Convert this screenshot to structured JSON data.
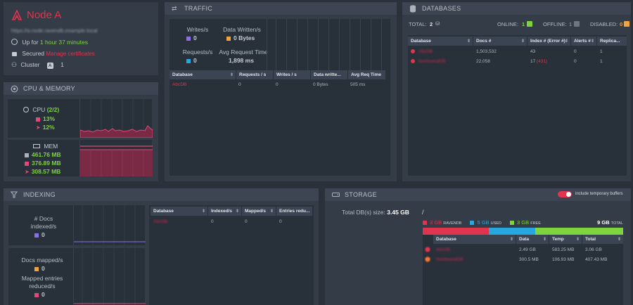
{
  "node": {
    "name": "Node A",
    "url": "https://a.node.ravendb.example.local",
    "uptime_label": "Up for",
    "uptime": "1 hour 37 minutes",
    "secured_label": "Secured",
    "manage_certs": "Manage certificates",
    "cluster_label": "Cluster",
    "cluster_node": "A",
    "cluster_count": "1"
  },
  "cpu_mem": {
    "title": "CPU & MEMORY",
    "cpu_label": "CPU",
    "cpu_cores": "(2/2)",
    "cpu_machine": "13%",
    "cpu_process": "12%",
    "mem_label": "MEM",
    "mem_total": "461.76 MB",
    "mem_working": "376.89 MB",
    "mem_managed": "308.57 MB"
  },
  "traffic": {
    "title": "TRAFFIC",
    "writes_label": "Writes/s",
    "writes": "0",
    "data_written_label": "Data Written/s",
    "data_written": "0 Bytes",
    "requests_label": "Requests/s",
    "requests": "0",
    "avg_req_label": "Avg Request Time",
    "avg_req": "1,898 ms",
    "columns": [
      "Database",
      "Requests / s",
      "Writes / s",
      "Data writte...",
      "Avg Req Time"
    ],
    "rows": [
      [
        "AbcDB",
        "0",
        "0",
        "0 Bytes",
        "505 ms"
      ]
    ]
  },
  "databases": {
    "title": "DATABASES",
    "total_label": "TOTAL:",
    "total": "2",
    "online_label": "ONLINE:",
    "online": "1",
    "offline_label": "OFFLINE:",
    "offline": "1",
    "disabled_label": "DISABLED:",
    "disabled": "0",
    "columns": [
      "Database",
      "Docs #",
      "Index # (Error #)",
      "Alerts #",
      "Replica..."
    ],
    "rows": [
      {
        "name": "AbcDB",
        "docs": "1,503,532",
        "index": "43",
        "errors": "",
        "alerts": "0",
        "replica": "1"
      },
      {
        "name": "NorthwindDB",
        "docs": "22,058",
        "index": "17",
        "errors": "(431)",
        "alerts": "0",
        "replica": "1"
      }
    ]
  },
  "indexing": {
    "title": "INDEXING",
    "docs_indexed_label": "# Docs indexed/s",
    "docs_indexed": "0",
    "docs_mapped_label": "Docs mapped/s",
    "docs_mapped": "0",
    "reduced_label": "Mapped entries reduced/s",
    "reduced": "0",
    "columns": [
      "Database",
      "Indexed/s",
      "Mapped/s",
      "Entries redu..."
    ],
    "rows": [
      [
        "AbcDB",
        "0",
        "0",
        "0"
      ]
    ]
  },
  "storage": {
    "title": "STORAGE",
    "toggle_label": "include temporary buffers",
    "total_label": "Total DB(s) size:",
    "total": "3.45 GB",
    "drive": "/",
    "ravendb_size": "3 GB",
    "ravendb_label": "RAVENDB",
    "used_size": "5 GB",
    "used_label": "USED",
    "free_size": "3 GB",
    "free_label": "FREE",
    "disk_total": "9 GB",
    "disk_total_label": "TOTAL",
    "bar": {
      "ravendb": 0.33,
      "used": 0.56,
      "free": 0.44
    },
    "columns": [
      "Database",
      "Data",
      "Temp",
      "Total"
    ],
    "rows": [
      {
        "name": "AbcDB",
        "data": "2.49 GB",
        "temp": "583.25 MB",
        "total": "3.06 GB"
      },
      {
        "name": "NorthwindDB",
        "data": "300.5 MB",
        "temp": "106.93 MB",
        "total": "407.43 MB"
      }
    ]
  },
  "colors": {
    "accent_red": "#e0344f",
    "green": "#7ed43d",
    "blue": "#27a7e0",
    "purple": "#8a6fe8",
    "orange": "#f3a33b",
    "pink": "#e04a78"
  }
}
